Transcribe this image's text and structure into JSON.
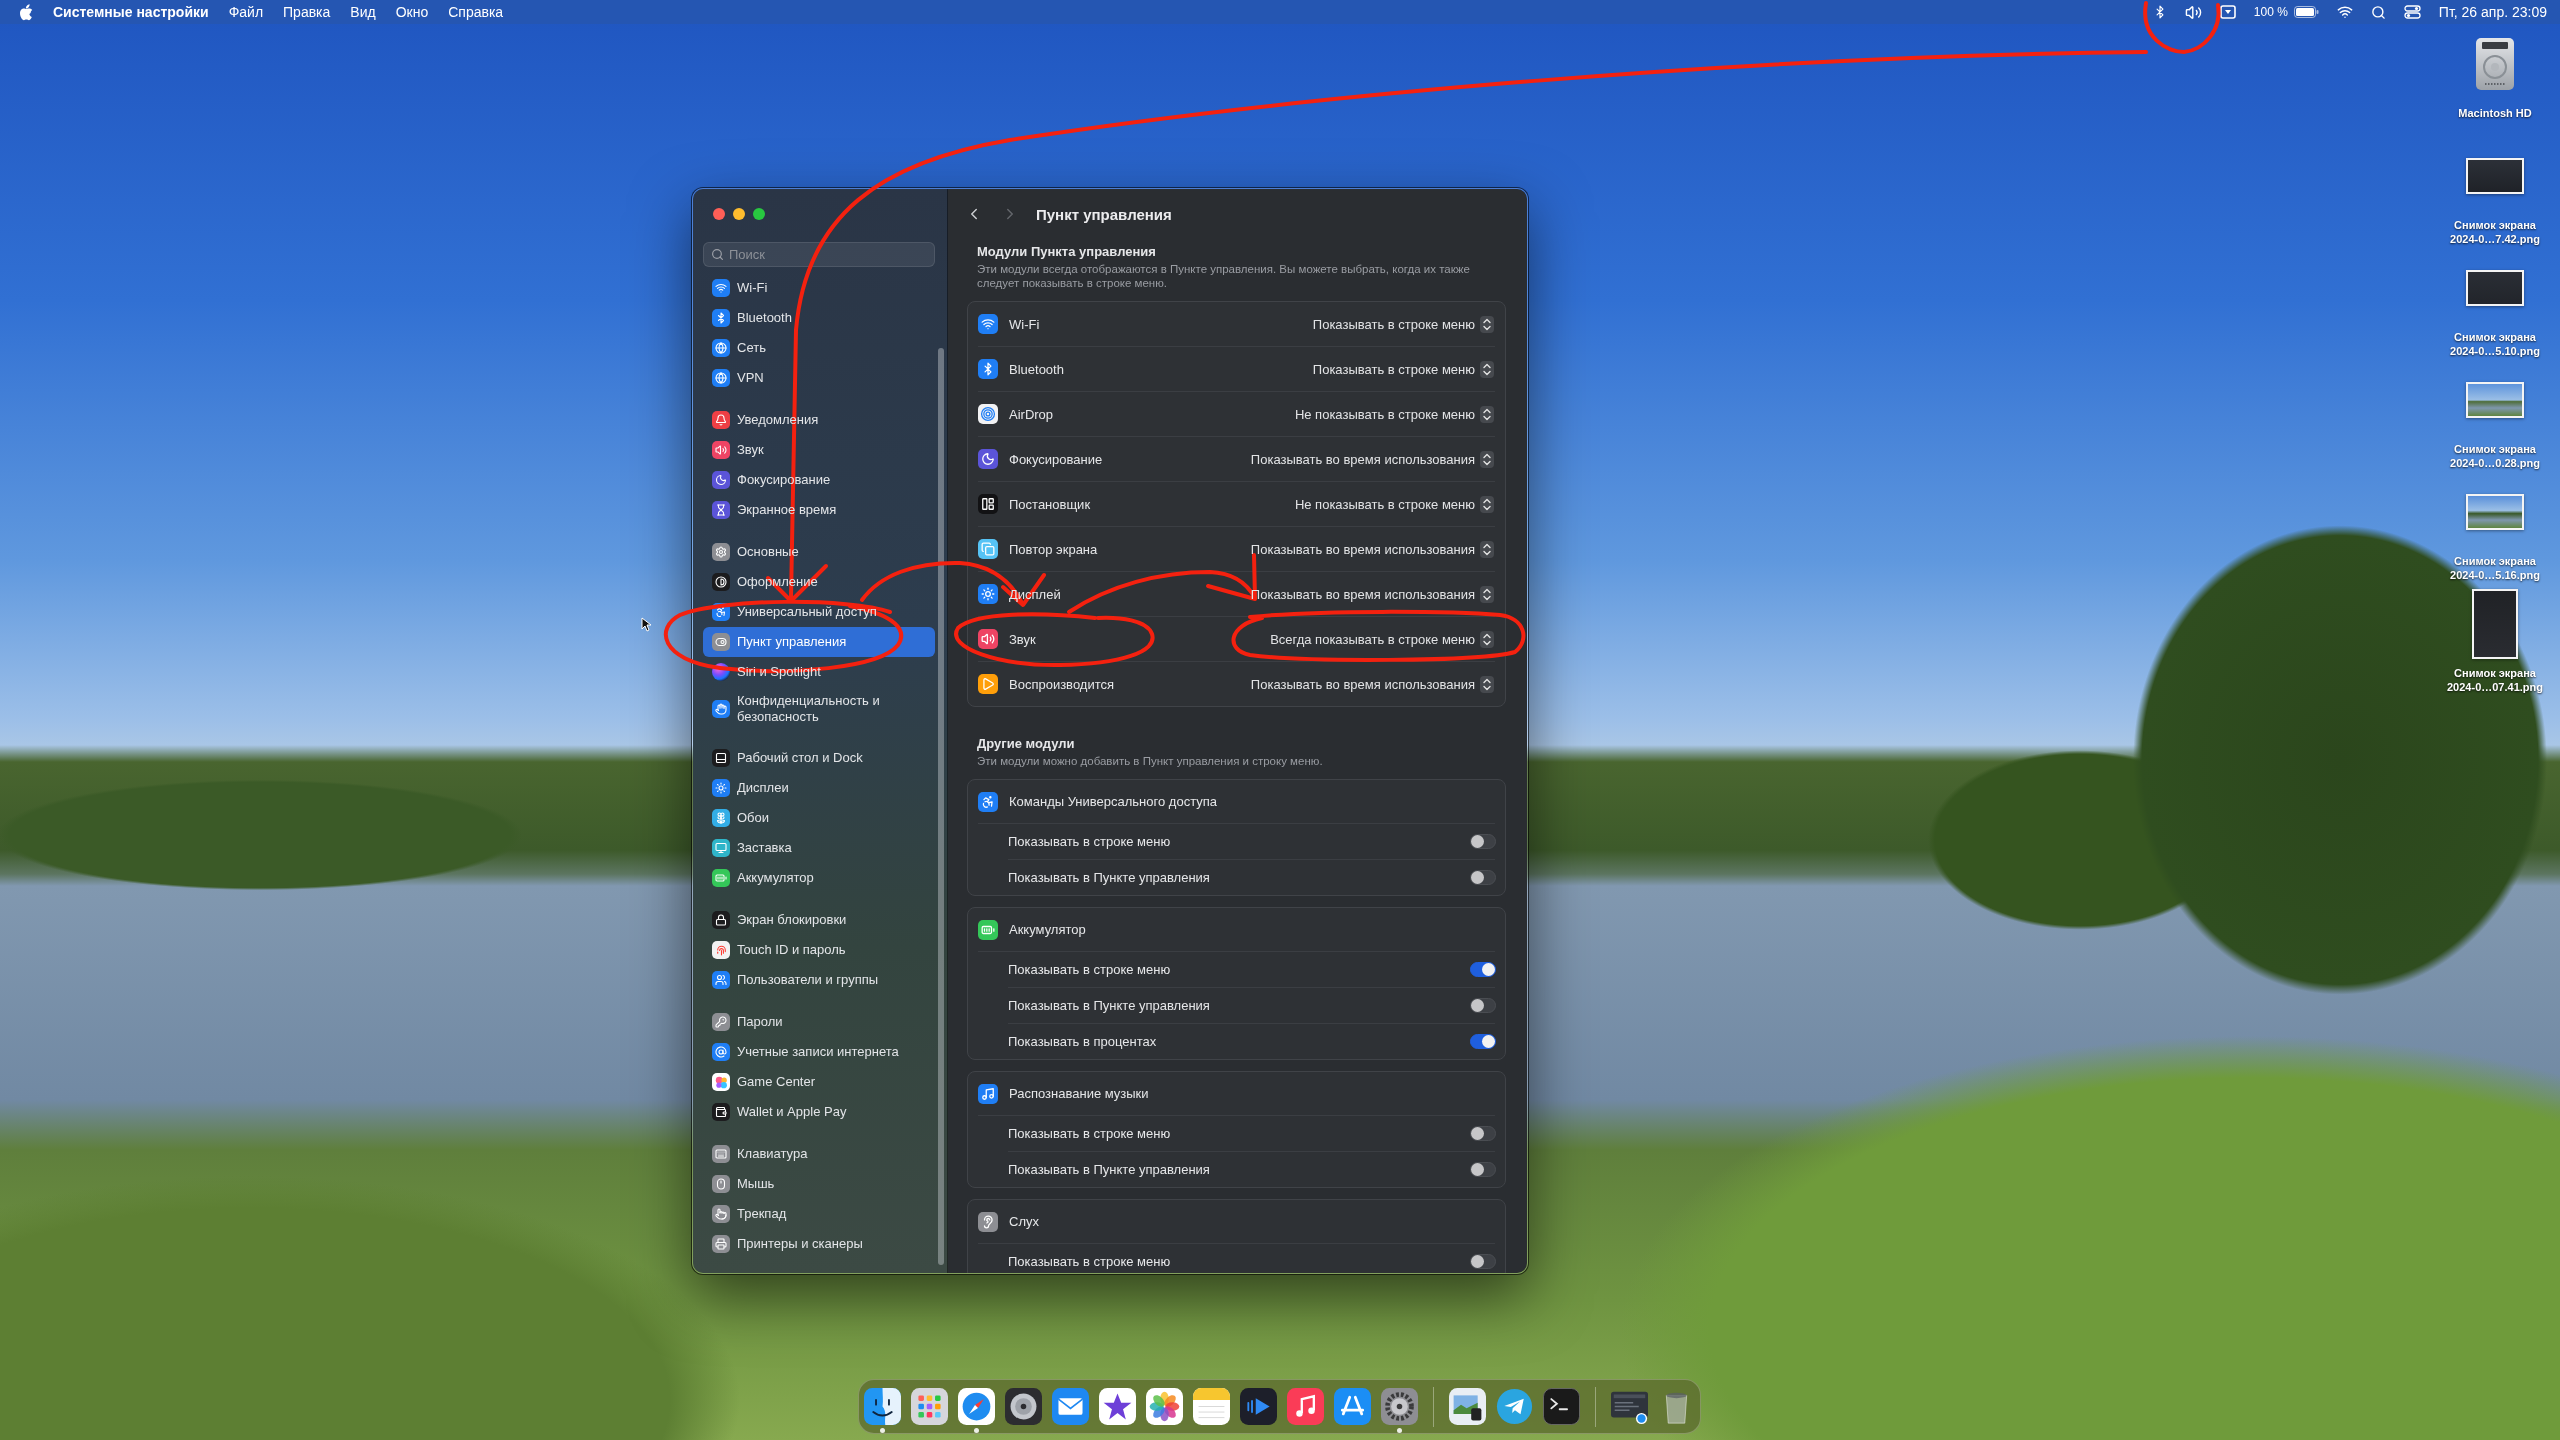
{
  "menu_bar": {
    "app": "Системные настройки",
    "menus": [
      "Файл",
      "Правка",
      "Вид",
      "Окно",
      "Справка"
    ],
    "battery": "100 %",
    "clock": "Пт, 26 апр. 23:09"
  },
  "window": {
    "sidebar": {
      "search": {
        "placeholder": "Поиск"
      },
      "groups": [
        {
          "items": [
            {
              "label": "Wi-Fi",
              "selected": false
            },
            {
              "label": "Bluetooth",
              "selected": false
            },
            {
              "label": "Сеть",
              "selected": false
            },
            {
              "label": "VPN",
              "selected": false
            }
          ]
        },
        {
          "items": [
            {
              "label": "Уведомления",
              "selected": false
            },
            {
              "label": "Звук",
              "selected": false
            },
            {
              "label": "Фокусирование",
              "selected": false
            },
            {
              "label": "Экранное время",
              "selected": false
            }
          ]
        },
        {
          "items": [
            {
              "label": "Основные",
              "selected": false
            },
            {
              "label": "Оформление",
              "selected": false
            },
            {
              "label": "Универсальный доступ",
              "selected": false
            },
            {
              "label": "Пункт управления",
              "selected": true
            },
            {
              "label": "Siri и Spotlight",
              "selected": false
            },
            {
              "label": "Конфиденциальность и безопасность",
              "selected": false
            }
          ]
        },
        {
          "items": [
            {
              "label": "Рабочий стол и Dock",
              "selected": false
            },
            {
              "label": "Дисплеи",
              "selected": false
            },
            {
              "label": "Обои",
              "selected": false
            },
            {
              "label": "Заставка",
              "selected": false
            },
            {
              "label": "Аккумулятор",
              "selected": false
            }
          ]
        },
        {
          "items": [
            {
              "label": "Экран блокировки",
              "selected": false
            },
            {
              "label": "Touch ID и пароль",
              "selected": false
            },
            {
              "label": "Пользователи и группы",
              "selected": false
            }
          ]
        },
        {
          "items": [
            {
              "label": "Пароли",
              "selected": false
            },
            {
              "label": "Учетные записи интернета",
              "selected": false
            },
            {
              "label": "Game Center",
              "selected": false
            },
            {
              "label": "Wallet и Apple Pay",
              "selected": false
            }
          ]
        },
        {
          "items": [
            {
              "label": "Клавиатура",
              "selected": false
            },
            {
              "label": "Мышь",
              "selected": false
            },
            {
              "label": "Трекпад",
              "selected": false
            },
            {
              "label": "Принтеры и сканеры",
              "selected": false
            }
          ]
        }
      ]
    },
    "header": {
      "title": "Пункт управления",
      "nav": [
        {
          "kind": "back",
          "disabled": false
        },
        {
          "kind": "forward",
          "disabled": true
        }
      ]
    },
    "modules": {
      "title": "Модули Пункта управления",
      "description": "Эти модули всегда отображаются в Пункте управления. Вы можете выбрать, когда их также следует показывать в строке меню.",
      "rows": [
        {
          "label": "Wi-Fi",
          "value": "Показывать в строке меню"
        },
        {
          "label": "Bluetooth",
          "value": "Показывать в строке меню"
        },
        {
          "label": "AirDrop",
          "value": "Не показывать в строке меню"
        },
        {
          "label": "Фокусирование",
          "value": "Показывать во время использования"
        },
        {
          "label": "Постановщик",
          "value": "Не показывать в строке меню"
        },
        {
          "label": "Повтор экрана",
          "value": "Показывать во время использования"
        },
        {
          "label": "Дисплей",
          "value": "Показывать во время использования"
        },
        {
          "label": "Звук",
          "value": "Всегда показывать в строке меню"
        },
        {
          "label": "Воспроизводится",
          "value": "Показывать во время использования"
        }
      ]
    },
    "other_modules": {
      "title": "Другие модули",
      "description": "Эти модули можно добавить в Пункт управления и строку меню.",
      "groups": [
        {
          "label": "Команды Универсального доступа",
          "options": [
            {
              "label": "Показывать в строке меню",
              "on": false
            },
            {
              "label": "Показывать в Пункте управления",
              "on": false
            }
          ]
        },
        {
          "label": "Аккумулятор",
          "options": [
            {
              "label": "Показывать в строке меню",
              "on": true
            },
            {
              "label": "Показывать в Пункте управления",
              "on": false
            },
            {
              "label": "Показывать в процентах",
              "on": true
            }
          ]
        },
        {
          "label": "Распознавание музыки",
          "options": [
            {
              "label": "Показывать в строке меню",
              "on": false
            },
            {
              "label": "Показывать в Пункте управления",
              "on": false
            }
          ]
        },
        {
          "label": "Слух",
          "options": [
            {
              "label": "Показывать в строке меню",
              "on": false
            }
          ]
        }
      ]
    }
  },
  "desktop_icons": [
    {
      "kind": "drive",
      "name": "Macintosh HD"
    },
    {
      "kind": "landscape",
      "name": "Снимок экрана 2024-0…7.42.png"
    },
    {
      "kind": "landscape",
      "name": "Снимок экрана 2024-0…5.10.png"
    },
    {
      "kind": "landscape",
      "name": "Снимок экрана 2024-0…0.28.png"
    },
    {
      "kind": "landscape",
      "name": "Снимок экрана 2024-0…5.16.png"
    },
    {
      "kind": "portrait",
      "name": "Снимок экрана 2024-0…07.41.png"
    }
  ],
  "dock": {
    "sections": [
      {
        "items": [
          {
            "running": true
          },
          {
            "running": false
          },
          {
            "running": true
          },
          {
            "running": false
          },
          {
            "running": false
          },
          {
            "running": false
          },
          {
            "running": false
          },
          {
            "running": false
          },
          {
            "running": false
          },
          {
            "running": false
          },
          {
            "running": false
          },
          {
            "running": true
          }
        ]
      },
      {
        "items": [
          {
            "running": false
          },
          {
            "running": false
          },
          {
            "running": false
          }
        ]
      },
      {
        "items": [
          {
            "running": false
          },
          {
            "running": false
          }
        ]
      }
    ]
  }
}
